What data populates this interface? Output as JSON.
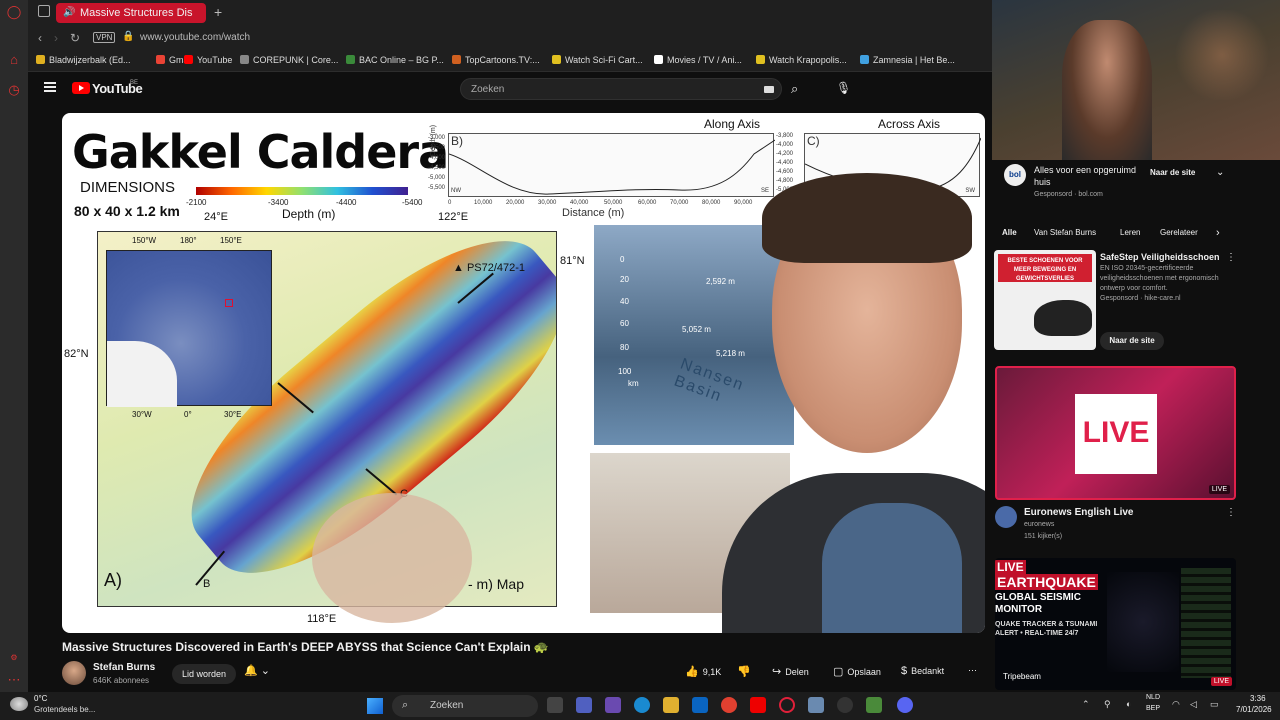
{
  "browser": {
    "active_tab": "Massive Structures Dis",
    "new_tab_icon": "plus-icon",
    "vpn_label": "VPN",
    "url": "www.youtube.com/watch",
    "bookmarks": [
      {
        "label": "Bladwijzerbalk (Ed...",
        "color": "#e0b020"
      },
      {
        "label": "Gmail",
        "color": "#ea4335"
      },
      {
        "label": "YouTube",
        "color": "#ff0000"
      },
      {
        "label": "COREPUNK | Core...",
        "color": "#888888"
      },
      {
        "label": "BAC Online – BG P...",
        "color": "#3a8a3a"
      },
      {
        "label": "TopCartoons.TV:...",
        "color": "#d06020"
      },
      {
        "label": "Watch Sci-Fi Cart...",
        "color": "#e0c020"
      },
      {
        "label": "Movies / TV / Ani...",
        "color": "#ffffff"
      },
      {
        "label": "Watch Krapopolis...",
        "color": "#e0c020"
      },
      {
        "label": "Zamnesia | Het Be...",
        "color": "#40a0e0"
      }
    ]
  },
  "youtube": {
    "logo": "YouTube",
    "country": "BE",
    "search_placeholder": "Zoeken"
  },
  "video": {
    "slide": {
      "title": "Gakkel Caldera",
      "dimensions_label": "DIMENSIONS",
      "size": "80 x 40 x 1.2 km",
      "colorbar_ticks": [
        "-2100",
        "-3400",
        "-4400",
        "-5400"
      ],
      "depth_label": "Depth (m)",
      "lon_top_left": "24°E",
      "lon_top_right": "122°E",
      "lon_bottom": "118°E",
      "lat_right": "81°N",
      "lat_left": "82°N",
      "inset_top": [
        "150°W",
        "180°",
        "150°E"
      ],
      "inset_bottom": [
        "30°W",
        "0°",
        "30°E"
      ],
      "site": "PS72/472-1",
      "panel_a": "A)",
      "label_b": "B",
      "label_c": "C",
      "map_caption": "- m) Map",
      "profile_b": {
        "panel": "B)",
        "title": "Along Axis",
        "ylabel": "Depth (m)",
        "yticks": [
          "-3,000",
          "-3,500",
          "-4,000",
          "-4,500",
          "-5,000",
          "-5,500"
        ],
        "xticks": [
          "0",
          "10,000",
          "20,000",
          "30,000",
          "40,000",
          "50,000",
          "60,000",
          "70,000",
          "80,000",
          "90,000"
        ],
        "xlabel": "Distance (m)",
        "left_end": "NW",
        "right_end": "SE"
      },
      "profile_c": {
        "panel": "C)",
        "title": "Across Axis",
        "yticks": [
          "-3,800",
          "-4,000",
          "-4,200",
          "-4,400",
          "-4,600",
          "-4,800",
          "-5,000"
        ],
        "right_end": "SW"
      },
      "bathy": {
        "scale": [
          "0",
          "20",
          "40",
          "60",
          "80",
          "100"
        ],
        "scale_unit": "km",
        "depths": [
          "2,592 m",
          "5,052 m",
          "5,218 m"
        ],
        "basin": "Nansen Basin"
      }
    },
    "title": "Massive Structures Discovered in Earth's DEEP ABYSS that Science Can't Explain 🐢",
    "channel": "Stefan Burns",
    "subscribers": "646K abonnees",
    "join": "Lid worden",
    "likes": "9,1K",
    "share": "Delen",
    "save": "Opslaan",
    "thanks": "Bedankt",
    "more": "⋯"
  },
  "sidebar_feed": {
    "ad_top": {
      "logo": "bol",
      "text": "Alles voor een opgeruimd huis",
      "sponsored": "Gesponsord",
      "domain": "bol.com",
      "cta": "Naar de site"
    },
    "chips": [
      "Alle",
      "Van Stefan Burns",
      "Leren",
      "Gerelateer"
    ],
    "ad2": {
      "banner_line1": "BESTE SCHOENEN VOOR",
      "banner_line2": "MEER BEWEGING EN",
      "banner_line3": "GEWICHTSVERLIES",
      "title": "SafeStep Veiligheidsschoen",
      "desc": "EN ISO 20345-gecertificeerde veiligheidsschoenen met ergonomisch ontwerp voor comfort.",
      "sponsored": "Gesponsord",
      "domain": "hike-care.nl",
      "cta": "Naar de site"
    },
    "live_video": {
      "thumb_text": "LIVE",
      "badge": "LIVE",
      "title": "Euronews English Live",
      "channel": "euronews",
      "viewers": "151 kijker(s)"
    },
    "quake_video": {
      "line1": "LIVE",
      "line2": "EARTHQUAKE",
      "line3": "GLOBAL SEISMIC MONITOR",
      "line4": "QUAKE TRACKER & TSUNAMI ALERT • REAL-TIME 24/7",
      "brand": "Tripebeam",
      "badge": "LIVE"
    }
  },
  "taskbar": {
    "temp": "0°C",
    "weather": "Grotendeels be...",
    "search": "Zoeken",
    "lang1": "NLD",
    "lang2": "BEP",
    "time": "3:36",
    "date": "7/01/2026"
  }
}
